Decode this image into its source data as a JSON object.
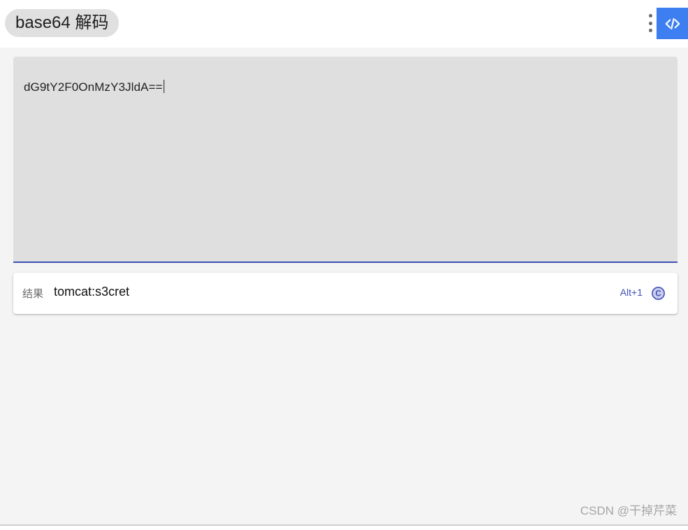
{
  "header": {
    "title": "base64 解码",
    "menu_icon": "more-vertical-icon",
    "code_icon": "code-icon",
    "accent_color": "#3d7ff0"
  },
  "input": {
    "value": "dG9tY2F0OnMzY3JldA=="
  },
  "result": {
    "label": "结果",
    "value": "tomcat:s3cret",
    "shortcut": "Alt+1",
    "copy_icon": "copy-icon",
    "copy_glyph": "C",
    "accent_color": "#3f51b5"
  },
  "watermark": "CSDN @干掉芹菜"
}
